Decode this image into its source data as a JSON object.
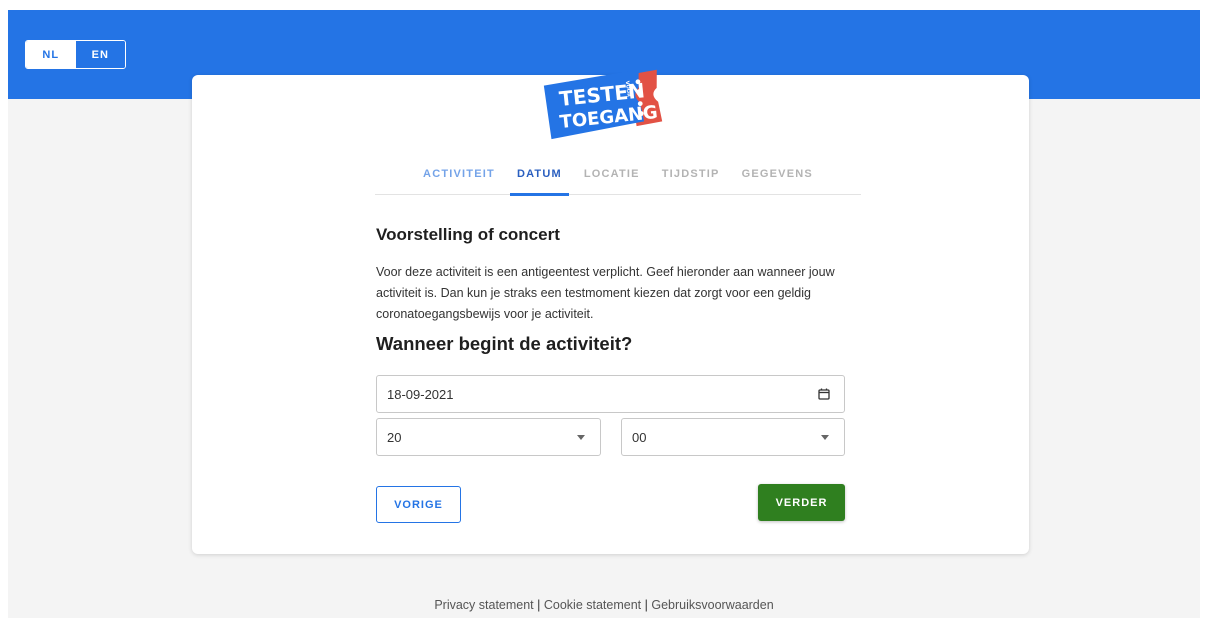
{
  "colors": {
    "brand_blue": "#2474e5",
    "ticket_red": "#e25245",
    "next_green": "#2f7f1f",
    "page_bg": "#f4f4f4"
  },
  "language": {
    "options": [
      {
        "label": "NL",
        "active": true
      },
      {
        "label": "EN",
        "active": false
      }
    ]
  },
  "logo": {
    "line1": "TESTEN",
    "line2": "TOEGANG",
    "small": "VOOR"
  },
  "steps": [
    {
      "label": "ACTIVITEIT",
      "state": "done"
    },
    {
      "label": "DATUM",
      "state": "current"
    },
    {
      "label": "LOCATIE",
      "state": "todo"
    },
    {
      "label": "TIJDSTIP",
      "state": "todo"
    },
    {
      "label": "GEGEVENS",
      "state": "todo"
    }
  ],
  "main": {
    "title": "Voorstelling of concert",
    "description": "Voor deze activiteit is een antigeentest verplicht. Geef hieronder aan wanneer jouw activiteit is. Dan kun je straks een testmoment kiezen dat zorgt voor een geldig coronatoegangsbewijs voor je activiteit.",
    "question": "Wanneer begint de activiteit?"
  },
  "form": {
    "date_value": "18-09-2021",
    "hour_value": "20",
    "minute_value": "00",
    "date_icon": "calendar-icon",
    "select_icon": "caret-down-icon"
  },
  "buttons": {
    "prev_label": "VORIGE",
    "next_label": "VERDER"
  },
  "footer": {
    "privacy": "Privacy statement",
    "cookie": "Cookie statement",
    "terms": "Gebruiksvoorwaarden",
    "separator": "|"
  }
}
